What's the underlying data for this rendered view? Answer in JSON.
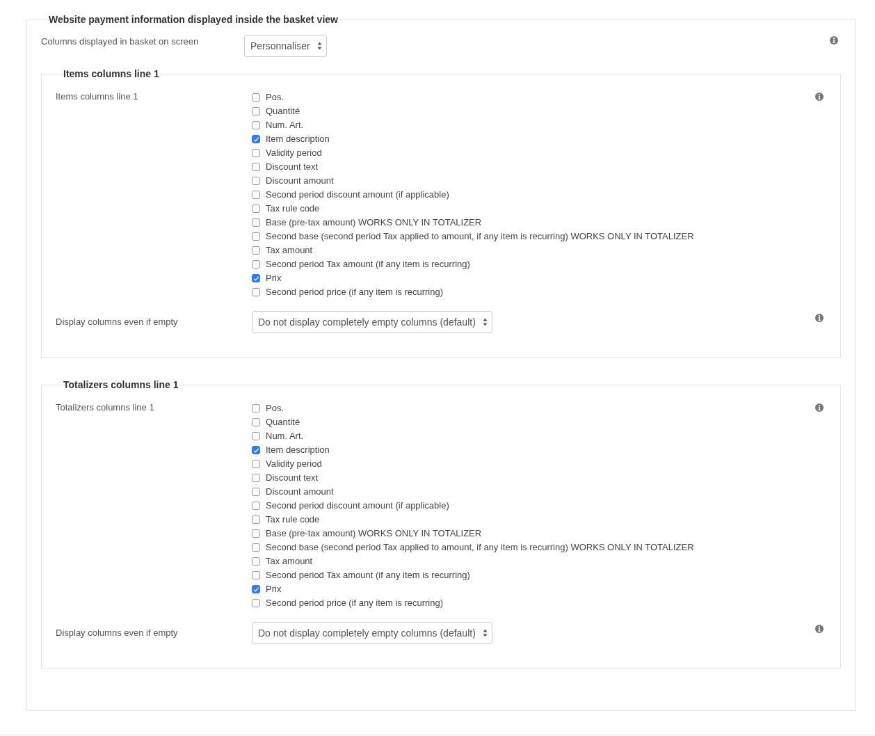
{
  "section": {
    "title": "Website payment information displayed inside the basket view",
    "field": {
      "label": "Columns displayed in basket on screen",
      "value": "Personnaliser"
    },
    "groups": [
      {
        "title": "Items columns line 1",
        "label": "Items columns line 1",
        "options": [
          {
            "label": "Pos.",
            "checked": false
          },
          {
            "label": "Quantité",
            "checked": false
          },
          {
            "label": "Num. Art.",
            "checked": false
          },
          {
            "label": "Item description",
            "checked": true
          },
          {
            "label": "Validity period",
            "checked": false
          },
          {
            "label": "Discount text",
            "checked": false
          },
          {
            "label": "Discount amount",
            "checked": false
          },
          {
            "label": "Second period discount amount (if applicable)",
            "checked": false
          },
          {
            "label": "Tax rule code",
            "checked": false
          },
          {
            "label": "Base (pre-tax amount) WORKS ONLY IN TOTALIZER",
            "checked": false
          },
          {
            "label": "Second base (second period Tax applied to amount, if any item is recurring) WORKS ONLY IN TOTALIZER",
            "checked": false
          },
          {
            "label": "Tax amount",
            "checked": false
          },
          {
            "label": "Second period Tax amount (if any item is recurring)",
            "checked": false
          },
          {
            "label": "Prix",
            "checked": true
          },
          {
            "label": "Second period price (if any item is recurring)",
            "checked": false
          }
        ],
        "display": {
          "label": "Display columns even if empty",
          "value": "Do not display completely empty columns (default)"
        }
      },
      {
        "title": "Totalizers columns line 1",
        "label": "Totalizers columns line 1",
        "options": [
          {
            "label": "Pos.",
            "checked": false
          },
          {
            "label": "Quantité",
            "checked": false
          },
          {
            "label": "Num. Art.",
            "checked": false
          },
          {
            "label": "Item description",
            "checked": true
          },
          {
            "label": "Validity period",
            "checked": false
          },
          {
            "label": "Discount text",
            "checked": false
          },
          {
            "label": "Discount amount",
            "checked": false
          },
          {
            "label": "Second period discount amount (if applicable)",
            "checked": false
          },
          {
            "label": "Tax rule code",
            "checked": false
          },
          {
            "label": "Base (pre-tax amount) WORKS ONLY IN TOTALIZER",
            "checked": false
          },
          {
            "label": "Second base (second period Tax applied to amount, if any item is recurring) WORKS ONLY IN TOTALIZER",
            "checked": false
          },
          {
            "label": "Tax amount",
            "checked": false
          },
          {
            "label": "Second period Tax amount (if any item is recurring)",
            "checked": false
          },
          {
            "label": "Prix",
            "checked": true
          },
          {
            "label": "Second period price (if any item is recurring)",
            "checked": false
          }
        ],
        "display": {
          "label": "Display columns even if empty",
          "value": "Do not display completely empty columns (default)"
        }
      }
    ]
  }
}
